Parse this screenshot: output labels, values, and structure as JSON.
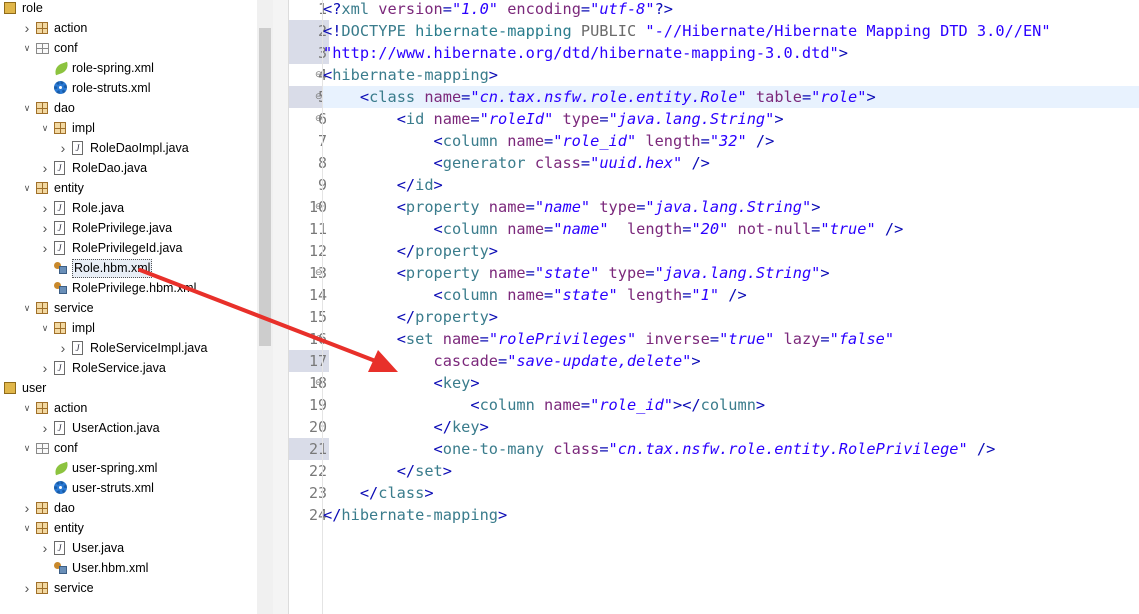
{
  "explorer": {
    "items": [
      {
        "label": "role",
        "icon": "project",
        "level": 0,
        "expanded": true,
        "toggle": false
      },
      {
        "label": "action",
        "icon": "package",
        "level": 1,
        "expanded": false,
        "toggle": true
      },
      {
        "label": "conf",
        "icon": "folder",
        "level": 1,
        "expanded": true,
        "toggle": true
      },
      {
        "label": "role-spring.xml",
        "icon": "spring",
        "level": 2,
        "toggle": false
      },
      {
        "label": "role-struts.xml",
        "icon": "struts",
        "level": 2,
        "toggle": false
      },
      {
        "label": "dao",
        "icon": "package",
        "level": 1,
        "expanded": true,
        "toggle": true
      },
      {
        "label": "impl",
        "icon": "package",
        "level": 2,
        "expanded": true,
        "toggle": true
      },
      {
        "label": "RoleDaoImpl.java",
        "icon": "java",
        "level": 3,
        "expanded": false,
        "toggle": true
      },
      {
        "label": "RoleDao.java",
        "icon": "java",
        "level": 2,
        "expanded": false,
        "toggle": true
      },
      {
        "label": "entity",
        "icon": "package",
        "level": 1,
        "expanded": true,
        "toggle": true
      },
      {
        "label": "Role.java",
        "icon": "java",
        "level": 2,
        "expanded": false,
        "toggle": true
      },
      {
        "label": "RolePrivilege.java",
        "icon": "java",
        "level": 2,
        "expanded": false,
        "toggle": true
      },
      {
        "label": "RolePrivilegeId.java",
        "icon": "java",
        "level": 2,
        "expanded": false,
        "toggle": true
      },
      {
        "label": "Role.hbm.xml",
        "icon": "hbm",
        "level": 2,
        "toggle": false,
        "selected": true
      },
      {
        "label": "RolePrivilege.hbm.xml",
        "icon": "hbm",
        "level": 2,
        "toggle": false
      },
      {
        "label": "service",
        "icon": "package",
        "level": 1,
        "expanded": true,
        "toggle": true
      },
      {
        "label": "impl",
        "icon": "package",
        "level": 2,
        "expanded": true,
        "toggle": true
      },
      {
        "label": "RoleServiceImpl.java",
        "icon": "java",
        "level": 3,
        "expanded": false,
        "toggle": true
      },
      {
        "label": "RoleService.java",
        "icon": "java",
        "level": 2,
        "expanded": false,
        "toggle": true
      },
      {
        "label": "user",
        "icon": "project",
        "level": 0,
        "expanded": true,
        "toggle": false
      },
      {
        "label": "action",
        "icon": "package",
        "level": 1,
        "expanded": true,
        "toggle": true
      },
      {
        "label": "UserAction.java",
        "icon": "java",
        "level": 2,
        "expanded": false,
        "toggle": true
      },
      {
        "label": "conf",
        "icon": "folder",
        "level": 1,
        "expanded": true,
        "toggle": true
      },
      {
        "label": "user-spring.xml",
        "icon": "spring",
        "level": 2,
        "toggle": false
      },
      {
        "label": "user-struts.xml",
        "icon": "struts",
        "level": 2,
        "toggle": false
      },
      {
        "label": "dao",
        "icon": "package",
        "level": 1,
        "expanded": false,
        "toggle": true
      },
      {
        "label": "entity",
        "icon": "package",
        "level": 1,
        "expanded": true,
        "toggle": true
      },
      {
        "label": "User.java",
        "icon": "java",
        "level": 2,
        "expanded": false,
        "toggle": true
      },
      {
        "label": "User.hbm.xml",
        "icon": "hbm",
        "level": 2,
        "toggle": false
      },
      {
        "label": "service",
        "icon": "package",
        "level": 1,
        "expanded": false,
        "toggle": true
      }
    ]
  },
  "editor": {
    "current_line": 5,
    "dirty_lines": [
      2,
      3,
      5,
      17,
      21
    ],
    "fold_lines": [
      4,
      5,
      6,
      10,
      13,
      16,
      18
    ],
    "lines": [
      [
        [
          "b",
          "<?"
        ],
        [
          "t",
          "xml "
        ],
        [
          "a",
          "version"
        ],
        [
          "b",
          "="
        ],
        [
          "v",
          "\"1.0\""
        ],
        [
          "a",
          " encoding"
        ],
        [
          "b",
          "="
        ],
        [
          "v",
          "\"utf-8\""
        ],
        [
          "b",
          "?>"
        ]
      ],
      [
        [
          "b",
          "<!"
        ],
        [
          "t",
          "DOCTYPE "
        ],
        [
          "dt",
          "hibernate-mapping "
        ],
        [
          "gr",
          "PUBLIC "
        ],
        [
          "v2",
          "\"-//Hibernate/Hibernate Mapping DTD 3.0//EN\""
        ]
      ],
      [
        [
          "v2",
          "\"http://www.hibernate.org/dtd/hibernate-mapping-3.0.dtd\""
        ],
        [
          "b",
          ">"
        ]
      ],
      [
        [
          "b",
          "<"
        ],
        [
          "t",
          "hibernate-mapping"
        ],
        [
          "b",
          ">"
        ]
      ],
      [
        [
          "p",
          "    "
        ],
        [
          "b",
          "<"
        ],
        [
          "t",
          "class "
        ],
        [
          "a",
          "name"
        ],
        [
          "b",
          "="
        ],
        [
          "v",
          "\"cn.tax.nsfw.role.entity.Role\""
        ],
        [
          "a",
          " table"
        ],
        [
          "b",
          "="
        ],
        [
          "v",
          "\"role\""
        ],
        [
          "b",
          ">"
        ]
      ],
      [
        [
          "p",
          "        "
        ],
        [
          "b",
          "<"
        ],
        [
          "t",
          "id "
        ],
        [
          "a",
          "name"
        ],
        [
          "b",
          "="
        ],
        [
          "v",
          "\"roleId\""
        ],
        [
          "a",
          " type"
        ],
        [
          "b",
          "="
        ],
        [
          "v",
          "\"java.lang.String\""
        ],
        [
          "b",
          ">"
        ]
      ],
      [
        [
          "p",
          "            "
        ],
        [
          "b",
          "<"
        ],
        [
          "t",
          "column "
        ],
        [
          "a",
          "name"
        ],
        [
          "b",
          "="
        ],
        [
          "v",
          "\"role_id\""
        ],
        [
          "a",
          " length"
        ],
        [
          "b",
          "="
        ],
        [
          "v",
          "\"32\""
        ],
        [
          "b",
          " />"
        ]
      ],
      [
        [
          "p",
          "            "
        ],
        [
          "b",
          "<"
        ],
        [
          "t",
          "generator "
        ],
        [
          "a",
          "class"
        ],
        [
          "b",
          "="
        ],
        [
          "v",
          "\"uuid.hex\""
        ],
        [
          "b",
          " />"
        ]
      ],
      [
        [
          "p",
          "        "
        ],
        [
          "b",
          "</"
        ],
        [
          "t",
          "id"
        ],
        [
          "b",
          ">"
        ]
      ],
      [
        [
          "p",
          "        "
        ],
        [
          "b",
          "<"
        ],
        [
          "t",
          "property "
        ],
        [
          "a",
          "name"
        ],
        [
          "b",
          "="
        ],
        [
          "v",
          "\"name\""
        ],
        [
          "a",
          " type"
        ],
        [
          "b",
          "="
        ],
        [
          "v",
          "\"java.lang.String\""
        ],
        [
          "b",
          ">"
        ]
      ],
      [
        [
          "p",
          "            "
        ],
        [
          "b",
          "<"
        ],
        [
          "t",
          "column "
        ],
        [
          "a",
          "name"
        ],
        [
          "b",
          "="
        ],
        [
          "v",
          "\"name\""
        ],
        [
          "a",
          "  length"
        ],
        [
          "b",
          "="
        ],
        [
          "v",
          "\"20\""
        ],
        [
          "a",
          " not-null"
        ],
        [
          "b",
          "="
        ],
        [
          "v",
          "\"true\""
        ],
        [
          "b",
          " />"
        ]
      ],
      [
        [
          "p",
          "        "
        ],
        [
          "b",
          "</"
        ],
        [
          "t",
          "property"
        ],
        [
          "b",
          ">"
        ]
      ],
      [
        [
          "p",
          "        "
        ],
        [
          "b",
          "<"
        ],
        [
          "t",
          "property "
        ],
        [
          "a",
          "name"
        ],
        [
          "b",
          "="
        ],
        [
          "v",
          "\"state\""
        ],
        [
          "a",
          " type"
        ],
        [
          "b",
          "="
        ],
        [
          "v",
          "\"java.lang.String\""
        ],
        [
          "b",
          ">"
        ]
      ],
      [
        [
          "p",
          "            "
        ],
        [
          "b",
          "<"
        ],
        [
          "t",
          "column "
        ],
        [
          "a",
          "name"
        ],
        [
          "b",
          "="
        ],
        [
          "v",
          "\"state\""
        ],
        [
          "a",
          " length"
        ],
        [
          "b",
          "="
        ],
        [
          "v",
          "\"1\""
        ],
        [
          "b",
          " />"
        ]
      ],
      [
        [
          "p",
          "        "
        ],
        [
          "b",
          "</"
        ],
        [
          "t",
          "property"
        ],
        [
          "b",
          ">"
        ]
      ],
      [
        [
          "p",
          "        "
        ],
        [
          "b",
          "<"
        ],
        [
          "t",
          "set "
        ],
        [
          "a",
          "name"
        ],
        [
          "b",
          "="
        ],
        [
          "v",
          "\"rolePrivileges\""
        ],
        [
          "a",
          " inverse"
        ],
        [
          "b",
          "="
        ],
        [
          "v",
          "\"true\""
        ],
        [
          "a",
          " lazy"
        ],
        [
          "b",
          "="
        ],
        [
          "v",
          "\"false\""
        ]
      ],
      [
        [
          "p",
          "            "
        ],
        [
          "a",
          "cascade"
        ],
        [
          "b",
          "="
        ],
        [
          "v",
          "\"save-update,delete\""
        ],
        [
          "b",
          ">"
        ]
      ],
      [
        [
          "p",
          "            "
        ],
        [
          "b",
          "<"
        ],
        [
          "t",
          "key"
        ],
        [
          "b",
          ">"
        ]
      ],
      [
        [
          "p",
          "                "
        ],
        [
          "b",
          "<"
        ],
        [
          "t",
          "column "
        ],
        [
          "a",
          "name"
        ],
        [
          "b",
          "="
        ],
        [
          "v",
          "\"role_id\""
        ],
        [
          "b",
          "></"
        ],
        [
          "t",
          "column"
        ],
        [
          "b",
          ">"
        ]
      ],
      [
        [
          "p",
          "            "
        ],
        [
          "b",
          "</"
        ],
        [
          "t",
          "key"
        ],
        [
          "b",
          ">"
        ]
      ],
      [
        [
          "p",
          "            "
        ],
        [
          "b",
          "<"
        ],
        [
          "t",
          "one-to-many "
        ],
        [
          "a",
          "class"
        ],
        [
          "b",
          "="
        ],
        [
          "v",
          "\"cn.tax.nsfw.role.entity.RolePrivilege\""
        ],
        [
          "b",
          " />"
        ]
      ],
      [
        [
          "p",
          "        "
        ],
        [
          "b",
          "</"
        ],
        [
          "t",
          "set"
        ],
        [
          "b",
          ">"
        ]
      ],
      [
        [
          "p",
          "    "
        ],
        [
          "b",
          "</"
        ],
        [
          "t",
          "class"
        ],
        [
          "b",
          ">"
        ]
      ],
      [
        [
          "b",
          "</"
        ],
        [
          "t",
          "hibernate-mapping"
        ],
        [
          "b",
          ">"
        ]
      ]
    ]
  },
  "annotation": {
    "color": "#e8302a"
  }
}
